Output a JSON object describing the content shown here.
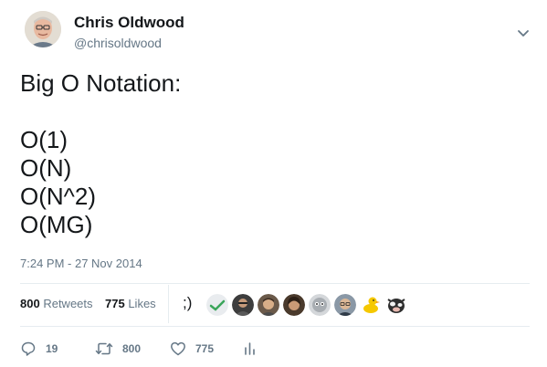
{
  "author": {
    "name": "Chris Oldwood",
    "handle": "@chrisoldwood",
    "avatar_icon": "profile-photo"
  },
  "menu_icon": "chevron-down-icon",
  "tweet": {
    "lines": [
      "Big O Notation:",
      "",
      "O(1)",
      "O(N)",
      "O(N^2)",
      "O(MG)"
    ]
  },
  "timestamp": "7:24 PM - 27 Nov 2014",
  "stats": {
    "retweets_count": "800",
    "retweets_label": "Retweets",
    "likes_count": "775",
    "likes_label": "Likes"
  },
  "liker_prefix": ";)",
  "likers": [
    {
      "icon": "avatar-check-mark",
      "color": "#e9ecef"
    },
    {
      "icon": "avatar-person-dark",
      "color": "#4a4a4a"
    },
    {
      "icon": "avatar-person-face",
      "color": "#c9a37e"
    },
    {
      "icon": "avatar-person-hair",
      "color": "#5b4636"
    },
    {
      "icon": "avatar-robot",
      "color": "#b9bcbf"
    },
    {
      "icon": "avatar-person-glasses",
      "color": "#7f8c99"
    },
    {
      "icon": "avatar-rubber-duck",
      "color": "#f5c800"
    },
    {
      "icon": "avatar-cow",
      "color": "#2f2f2f"
    }
  ],
  "actions": {
    "reply_count": "19",
    "retweet_count": "800",
    "like_count": "775"
  },
  "colors": {
    "text": "#14171a",
    "secondary": "#657786",
    "divider": "#e6ecf0"
  }
}
